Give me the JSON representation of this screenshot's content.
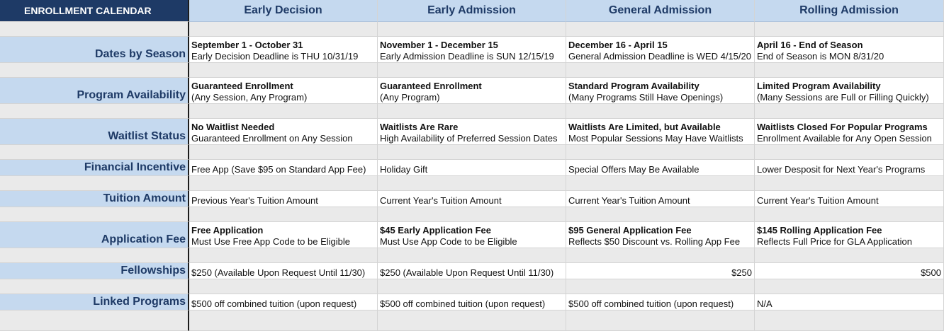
{
  "header": {
    "title": "ENROLLMENT CALENDAR",
    "columns": [
      "Early Decision",
      "Early Admission",
      "General Admission",
      "Rolling Admission"
    ]
  },
  "rows": [
    {
      "label": "Dates by Season",
      "cells": [
        {
          "title": "September 1 - October 31",
          "text": "Early Decision Deadline is THU 10/31/19"
        },
        {
          "title": "November 1 - December 15",
          "text": "Early Admission Deadline is SUN 12/15/19"
        },
        {
          "title": "December 16 - April 15",
          "text": "General Admission Deadline is WED 4/15/20"
        },
        {
          "title": "April 16 - End of Season",
          "text": "End of Season is MON 8/31/20"
        }
      ]
    },
    {
      "label": "Program Availability",
      "cells": [
        {
          "title": "Guaranteed Enrollment",
          "text": "(Any Session, Any Program)"
        },
        {
          "title": "Guaranteed Enrollment",
          "text": "(Any Program)"
        },
        {
          "title": "Standard Program Availability",
          "text": "(Many Programs Still Have Openings)"
        },
        {
          "title": "Limited Program Availability",
          "text": "(Many Sessions are Full or Filling Quickly)"
        }
      ]
    },
    {
      "label": "Waitlist Status",
      "cells": [
        {
          "title": "No Waitlist Needed",
          "text": "Guaranteed Enrollment on Any Session"
        },
        {
          "title": "Waitlists Are Rare",
          "text": "High Availability of Preferred Session Dates"
        },
        {
          "title": "Waitlists Are Limited, but Available",
          "text": "Most Popular Sessions May Have Waitlists"
        },
        {
          "title": "Waitlists Closed For Popular Programs",
          "text": "Enrollment Available for Any Open Session"
        }
      ]
    },
    {
      "label": "Financial Incentive",
      "cells": [
        {
          "text": "Free App (Save $95 on Standard App Fee)"
        },
        {
          "text": "Holiday Gift"
        },
        {
          "text": "Special Offers May Be Available"
        },
        {
          "text": "Lower Desposit for Next Year's Programs"
        }
      ]
    },
    {
      "label": "Tuition Amount",
      "cells": [
        {
          "text": "Previous Year's Tuition Amount"
        },
        {
          "text": "Current Year's Tuition Amount"
        },
        {
          "text": "Current Year's Tuition Amount"
        },
        {
          "text": "Current Year's Tuition Amount"
        }
      ]
    },
    {
      "label": "Application Fee",
      "cells": [
        {
          "title": "Free Application",
          "text": "Must Use Free App Code to be Eligible"
        },
        {
          "title": "$45 Early Application Fee",
          "text": "Must Use App Code to be Eligible"
        },
        {
          "title": "$95 General Application Fee",
          "text": "Reflects $50 Discount vs. Rolling App Fee"
        },
        {
          "title": "$145 Rolling Application Fee",
          "text": "Reflects Full Price for GLA Application"
        }
      ]
    },
    {
      "label": "Fellowships",
      "cells": [
        {
          "text": "$250 (Available Upon Request Until 11/30)"
        },
        {
          "text": "$250 (Available Upon Request Until 11/30)"
        },
        {
          "text": "$250"
        },
        {
          "text": "$500"
        }
      ]
    },
    {
      "label": "Linked Programs",
      "cells": [
        {
          "text": "$500 off combined tuition (upon request)"
        },
        {
          "text": "$500 off combined tuition (upon request)"
        },
        {
          "text": "$500 off combined tuition (upon request)"
        },
        {
          "text": "N/A"
        }
      ]
    }
  ]
}
